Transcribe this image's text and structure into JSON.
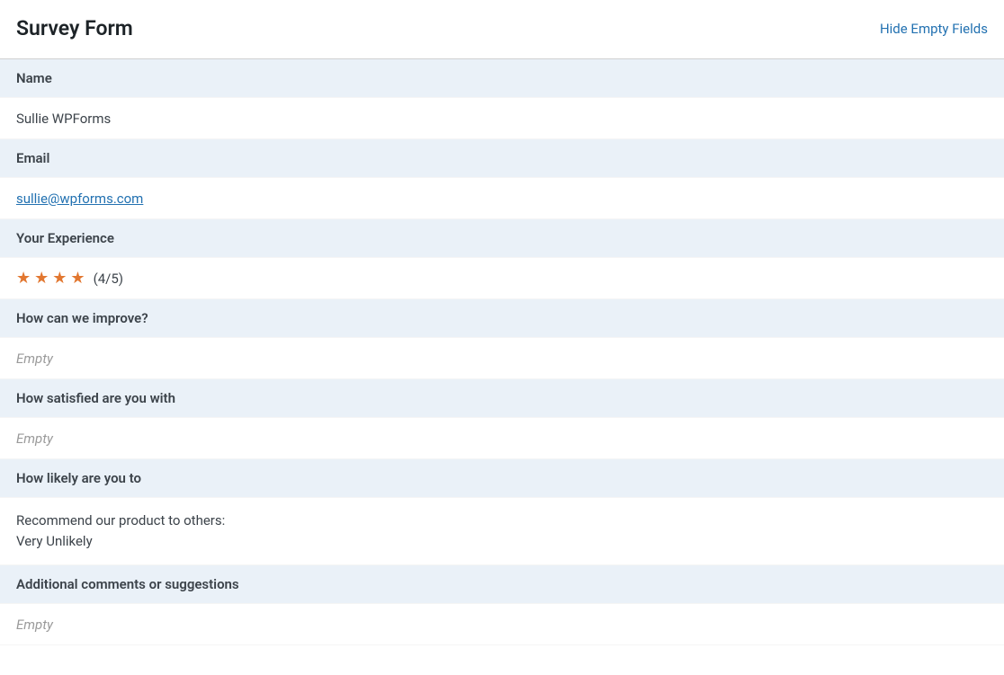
{
  "header": {
    "title": "Survey Form",
    "toggle_label": "Hide Empty Fields"
  },
  "fields": {
    "name": {
      "label": "Name",
      "value": "Sullie WPForms"
    },
    "email": {
      "label": "Email",
      "value": "sullie@wpforms.com"
    },
    "experience": {
      "label": "Your Experience",
      "rating_numeric": 4,
      "rating_max": 5,
      "rating_display": "(4/5)"
    },
    "improve": {
      "label": "How can we improve?",
      "empty_text": "Empty"
    },
    "satisfied": {
      "label": "How satisfied are you with",
      "empty_text": "Empty"
    },
    "likely": {
      "label": "How likely are you to",
      "value": "Recommend our product to others:\nVery Unlikely"
    },
    "additional": {
      "label": "Additional comments or suggestions",
      "empty_text": "Empty"
    }
  },
  "icons": {
    "star_filled": "★"
  }
}
